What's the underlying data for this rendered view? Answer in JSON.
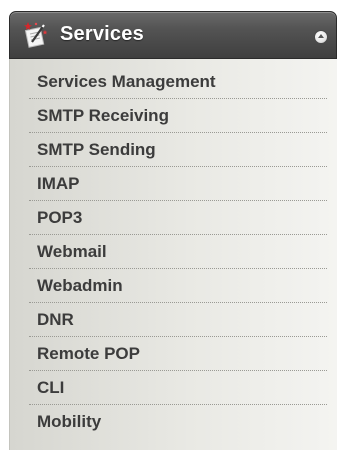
{
  "panel": {
    "title": "Services",
    "title_icon": "services-wand-icon",
    "collapse_icon": "collapse-up-icon"
  },
  "menu": {
    "items": [
      {
        "label": "Services Management"
      },
      {
        "label": "SMTP Receiving"
      },
      {
        "label": "SMTP Sending"
      },
      {
        "label": "IMAP"
      },
      {
        "label": "POP3"
      },
      {
        "label": "Webmail"
      },
      {
        "label": "Webadmin"
      },
      {
        "label": "DNR"
      },
      {
        "label": "Remote POP"
      },
      {
        "label": "CLI"
      },
      {
        "label": "Mobility"
      }
    ]
  },
  "colors": {
    "header_bg": "#4d4d4d",
    "header_text": "#ffffff",
    "item_text": "#3c3c3c",
    "body_bg": "#e9e9e4"
  }
}
